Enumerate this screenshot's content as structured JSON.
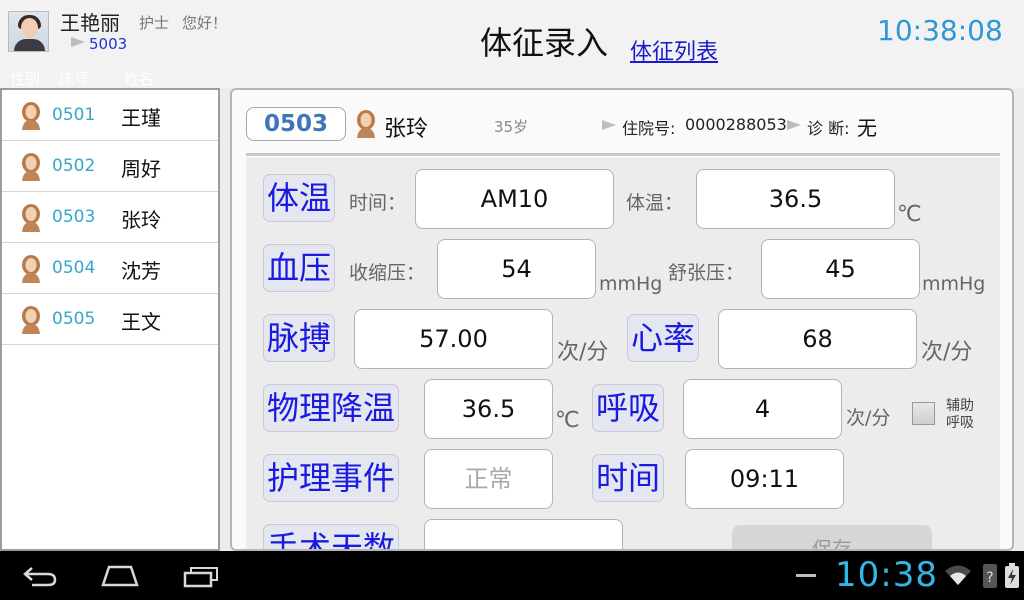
{
  "user": {
    "name": "王艳丽",
    "role": "护士",
    "greeting": "您好！",
    "id": "5003"
  },
  "header": {
    "title": "体征录入",
    "list_link": "体征列表",
    "time": "10:38:08"
  },
  "list_columns": [
    "性别",
    "床号",
    "姓名"
  ],
  "patients": [
    {
      "bed": "0501",
      "name": "王瑾"
    },
    {
      "bed": "0502",
      "name": "周好"
    },
    {
      "bed": "0503",
      "name": "张玲"
    },
    {
      "bed": "0504",
      "name": "沈芳"
    },
    {
      "bed": "0505",
      "name": "王文"
    }
  ],
  "selected": {
    "bed": "0503",
    "name": "张玲",
    "age": "35岁",
    "admission_label": "住院号:",
    "admission_no": "0000288053",
    "diagnosis_label": "诊 断:",
    "diagnosis": "无"
  },
  "form": {
    "temperature": {
      "button": "体温",
      "time_label": "时间：",
      "time_value": "AM10",
      "temp_label": "体温：",
      "temp_value": "36.5",
      "unit": "℃"
    },
    "blood_pressure": {
      "button": "血压",
      "systolic_label": "收缩压：",
      "systolic_value": "54",
      "systolic_unit": "mmHg",
      "diastolic_label": "舒张压：",
      "diastolic_value": "45",
      "diastolic_unit": "mmHg"
    },
    "pulse": {
      "button": "脉搏",
      "value": "57.00",
      "unit": "次/分"
    },
    "heart_rate": {
      "button": "心率",
      "value": "68",
      "unit": "次/分"
    },
    "cooling": {
      "button": "物理降温",
      "value": "36.5",
      "unit": "℃"
    },
    "respiration": {
      "button": "呼吸",
      "value": "4",
      "unit": "次/分",
      "assist_line1": "辅助",
      "assist_line2": "呼吸"
    },
    "nursing_event": {
      "button": "护理事件",
      "placeholder": "正常"
    },
    "event_time": {
      "button": "时间",
      "value": "09:11"
    },
    "surgery_days": {
      "button": "手术天数"
    },
    "save": {
      "label": "保存"
    }
  },
  "system_bar": {
    "time": "10:38"
  },
  "colors": {
    "accent": "#2f97d6",
    "category_text": "#1a1ae0",
    "bed_text": "#35a7c9"
  }
}
